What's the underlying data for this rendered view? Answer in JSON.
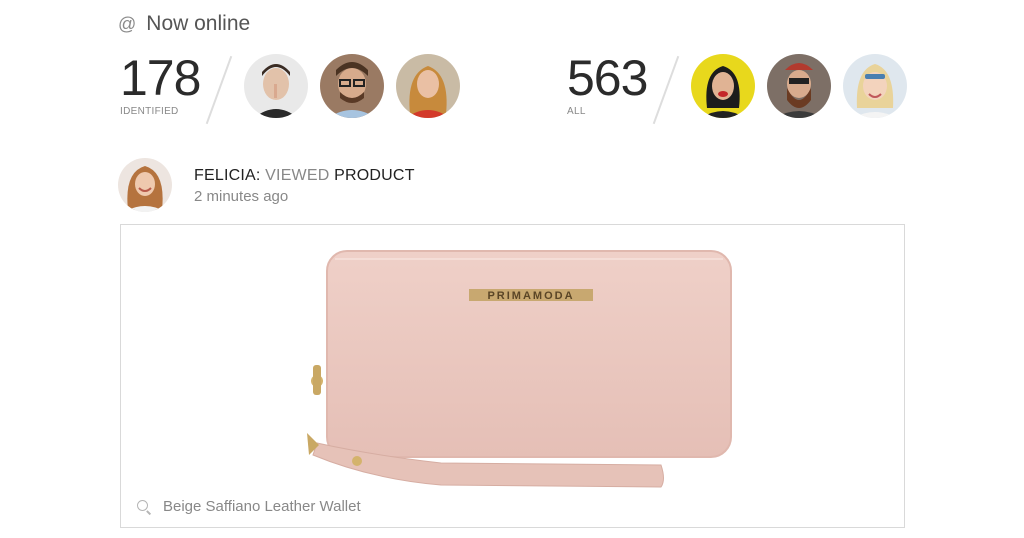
{
  "header": {
    "icon": "at-icon",
    "title": "Now online"
  },
  "stats": {
    "identified": {
      "count": "178",
      "label": "IDENTIFIED",
      "avatars": [
        "man-shh-avatar",
        "man-glasses-avatar",
        "woman-red-avatar"
      ]
    },
    "all": {
      "count": "563",
      "label": "ALL",
      "avatars": [
        "woman-yellow-avatar",
        "man-beard-avatar",
        "woman-blonde-avatar"
      ]
    }
  },
  "activity": {
    "user": "FELICIA:",
    "verb": "VIEWED",
    "object": "PRODUCT",
    "time": "2 minutes ago"
  },
  "product": {
    "brand": "PRIMAMODA",
    "name": "Beige Saffiano Leather Wallet",
    "color": "#eac8c0"
  }
}
